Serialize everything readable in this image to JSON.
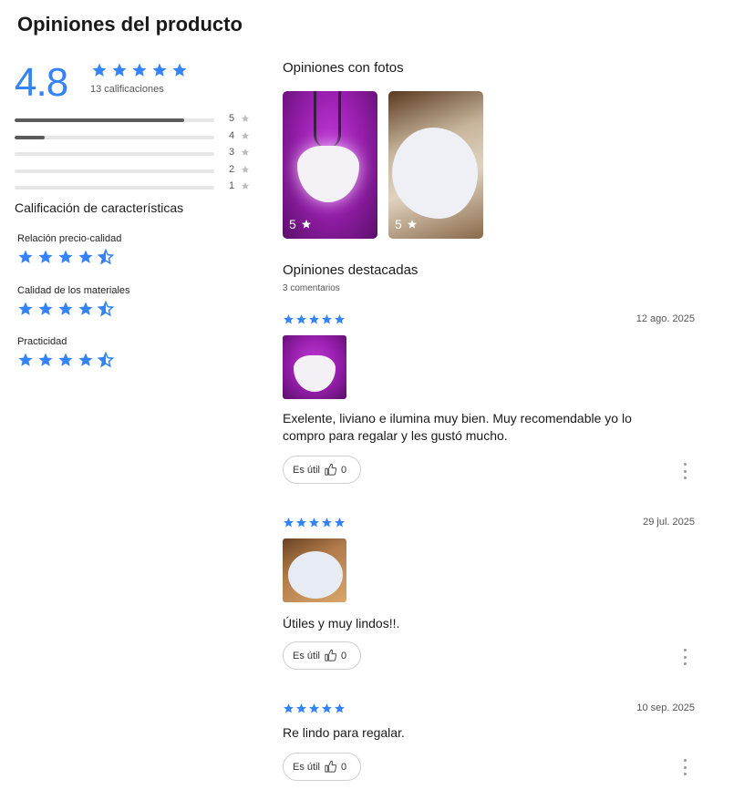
{
  "page": {
    "title": "Opiniones del producto"
  },
  "summary": {
    "average": "4.8",
    "stars": 5,
    "ratings_count": "13 calificaciones",
    "distribution": [
      {
        "label": "5",
        "fraction": 0.85
      },
      {
        "label": "4",
        "fraction": 0.15
      },
      {
        "label": "3",
        "fraction": 0
      },
      {
        "label": "2",
        "fraction": 0
      },
      {
        "label": "1",
        "fraction": 0
      }
    ]
  },
  "characteristics": {
    "title": "Calificación de características",
    "items": [
      {
        "label": "Relación precio-calidad",
        "rating": 4.5
      },
      {
        "label": "Calidad de los materiales",
        "rating": 4.5
      },
      {
        "label": "Practicidad",
        "rating": 4.5
      }
    ]
  },
  "photos_section": {
    "title": "Opiniones con fotos",
    "photos": [
      {
        "rating": "5"
      },
      {
        "rating": "5"
      }
    ]
  },
  "featured": {
    "title": "Opiniones destacadas",
    "comments_count": "3 comentarios",
    "reviews": [
      {
        "stars": 5,
        "date": "12 ago. 2025",
        "text": "Exelente, liviano e ilumina muy bien. Muy recomendable yo lo compro para regalar y les gustó mucho.",
        "helpful_label": "Es útil",
        "helpful_count": "0"
      },
      {
        "stars": 5,
        "date": "29 jul. 2025",
        "text": "Útiles y muy lindos!!.",
        "helpful_label": "Es útil",
        "helpful_count": "0"
      },
      {
        "stars": 5,
        "date": "10 sep. 2025",
        "text": "Re lindo para regalar.",
        "helpful_label": "Es útil",
        "helpful_count": "0"
      }
    ]
  },
  "colors": {
    "accent": "#3483fa",
    "bar_fill": "#5b5b5b",
    "bar_track": "#e6e6e6",
    "gray_star": "#bdbdbd"
  }
}
